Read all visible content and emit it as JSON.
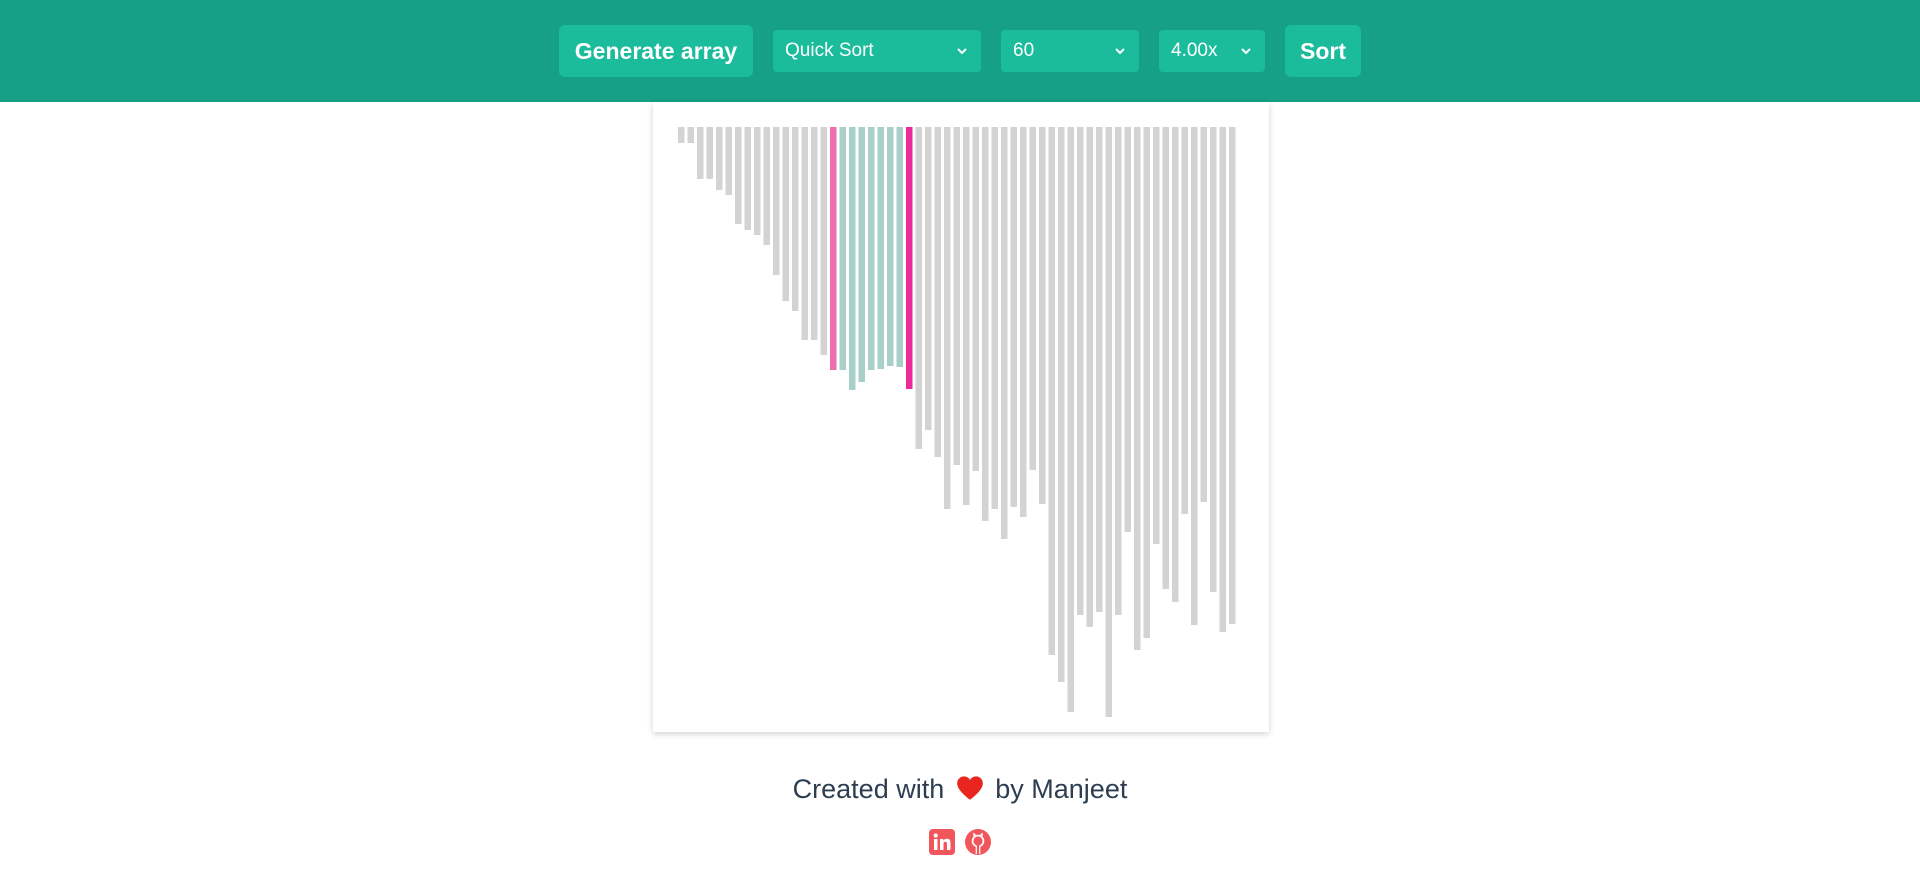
{
  "header": {
    "generate_label": "Generate array",
    "algorithm": "Quick Sort",
    "array_size": "60",
    "speed": "4.00x",
    "sort_label": "Sort"
  },
  "colors": {
    "header_bg": "#16a085",
    "button_bg": "#1abc9c",
    "bar_default": "#d3d3d3",
    "bar_range": "#a8cfc8",
    "bar_compare": "#ee6fae",
    "bar_pivot": "#ec2a9a",
    "heart": "#e8261f",
    "social": "#f0565b"
  },
  "bars": {
    "values": [
      16,
      16,
      52,
      52,
      63,
      68,
      97,
      103,
      108,
      118,
      148,
      174,
      184,
      213,
      213,
      228,
      243,
      243,
      263,
      255,
      243,
      242,
      239,
      240,
      262,
      322,
      303,
      330,
      382,
      338,
      378,
      344,
      394,
      382,
      412,
      380,
      390,
      343,
      377,
      528,
      555,
      585,
      488,
      500,
      485,
      590,
      488,
      405,
      523,
      511,
      417,
      462,
      475,
      387,
      498,
      375,
      465,
      505,
      497
    ],
    "range_indices": [
      17,
      18,
      19,
      20,
      21,
      22,
      23
    ],
    "compare_index": 16,
    "pivot_index": 24
  },
  "footer": {
    "text_before": "Created with",
    "text_after": "by Manjeet",
    "links": [
      "linkedin",
      "github"
    ]
  }
}
